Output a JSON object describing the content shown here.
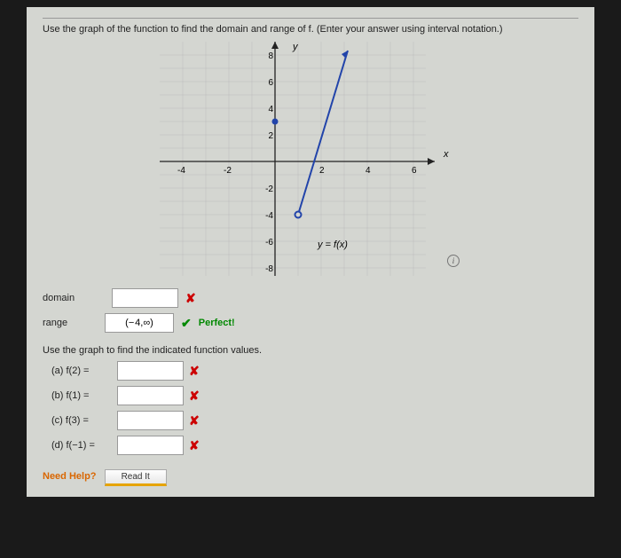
{
  "question": {
    "prompt": "Use the graph of the function to find the domain and range of f. (Enter your answer using interval notation.)",
    "sub_prompt": "Use the graph to find the indicated function values."
  },
  "chart_data": {
    "type": "line",
    "xlabel": "x",
    "ylabel": "y",
    "xlim": [
      -5,
      6.5
    ],
    "ylim": [
      -9,
      9
    ],
    "x_ticks": [
      -4,
      -2,
      2,
      4,
      6
    ],
    "y_ticks": [
      -8,
      -6,
      -4,
      -2,
      2,
      4,
      6,
      8
    ],
    "annotation": "y = f(x)",
    "series": [
      {
        "name": "f(x)",
        "points": [
          {
            "x": 1,
            "y": -4,
            "endpoint": "open"
          },
          {
            "x": 3,
            "y": 8
          }
        ]
      }
    ],
    "extra_points": [
      {
        "x": 0,
        "y": 3,
        "filled": true
      }
    ]
  },
  "answers": {
    "domain": {
      "label": "domain",
      "value": "",
      "feedback": "wrong"
    },
    "range": {
      "label": "range",
      "value": "(− 4,∞)",
      "feedback": "correct",
      "feedback_text": "Perfect!"
    }
  },
  "parts": [
    {
      "key": "a",
      "label": "(a)  f(2) =",
      "value": "",
      "feedback": "wrong"
    },
    {
      "key": "b",
      "label": "(b)  f(1) =",
      "value": "",
      "feedback": "wrong"
    },
    {
      "key": "c",
      "label": "(c)  f(3) =",
      "value": "",
      "feedback": "wrong"
    },
    {
      "key": "d",
      "label": "(d)  f(−1) =",
      "value": "",
      "feedback": "wrong"
    }
  ],
  "help": {
    "label": "Need Help?",
    "read_it": "Read It"
  },
  "icons": {
    "wrong": "✘",
    "correct": "✔",
    "info": "i"
  }
}
